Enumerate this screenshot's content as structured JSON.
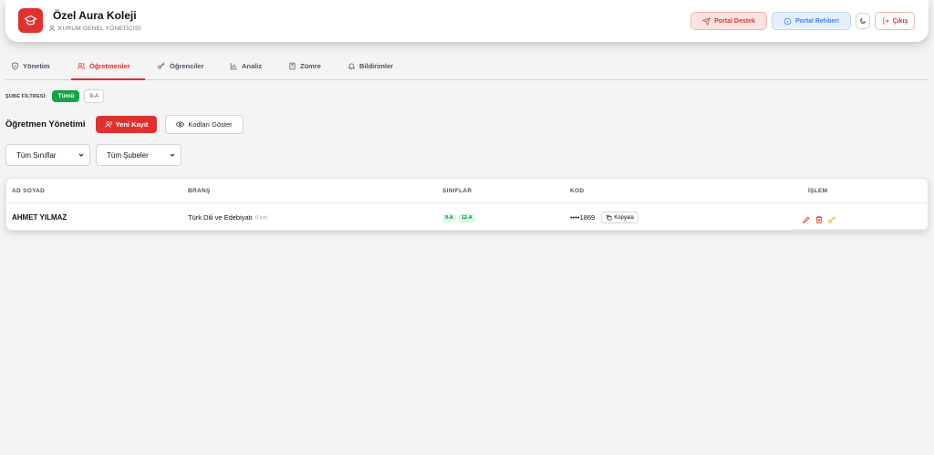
{
  "header": {
    "school_name": "Özel Aura Koleji",
    "role": "KURUM GENEL YÖNETİCİSİ",
    "btn_support": "Portal Destek",
    "btn_guide": "Portal Rehberi",
    "btn_logout": "Çıkış"
  },
  "tabs": [
    {
      "label": "Yönetim",
      "icon": "shield-icon",
      "active": false
    },
    {
      "label": "Öğretmenler",
      "icon": "users-icon",
      "active": true
    },
    {
      "label": "Öğrenciler",
      "icon": "key-icon",
      "active": false
    },
    {
      "label": "Analiz",
      "icon": "chart-icon",
      "active": false
    },
    {
      "label": "Zümre",
      "icon": "book-icon",
      "active": false
    },
    {
      "label": "Bildirimler",
      "icon": "bell-icon",
      "active": false
    }
  ],
  "filter": {
    "label": "ŞUBE FİLTRESİ:",
    "options": [
      "Tümü",
      "9-A"
    ]
  },
  "section": {
    "title": "Öğretmen Yönetimi",
    "btn_new": "Yeni Kayıt",
    "btn_codes": "Kodları Göster"
  },
  "selects": {
    "classes": "Tüm Sınıflar",
    "branches": "Tüm Şubeler"
  },
  "table": {
    "headers": [
      "AD SOYAD",
      "BRANŞ",
      "SINIFLAR",
      "KOD",
      "İŞLEM"
    ],
    "rows": [
      {
        "name": "AHMET YILMAZ",
        "branch": "Türk Dili ve Edebiyatı",
        "branch_level": "(Lise)",
        "classes": [
          "9-A",
          "12-A"
        ],
        "code": "••••1869",
        "copy_label": "Kopyala"
      }
    ]
  },
  "colors": {
    "accent": "#e03131",
    "success": "#16a34a",
    "info": "#3b82f6"
  }
}
